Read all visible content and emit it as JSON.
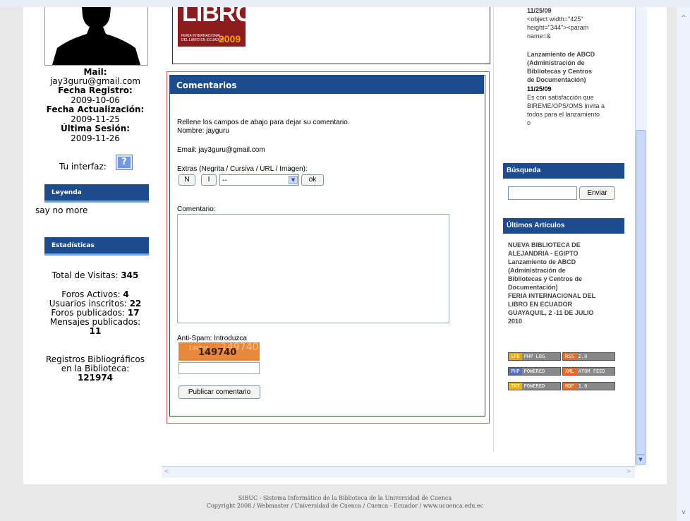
{
  "profile": {
    "mail_label": "Mail:",
    "mail_value": "jay3guru@gmail.com",
    "registro_label": "Fecha Registro:",
    "registro_value": "2009-10-06",
    "actualizacion_label": "Fecha Actualización:",
    "actualizacion_value": "2009-11-25",
    "sesion_label": "Última Sesión:",
    "sesion_value": "2009-11-26",
    "interfaz_label": "Tu interfaz:",
    "interfaz_icon": "?"
  },
  "leyenda": {
    "title": "Leyenda",
    "text": "say no more"
  },
  "estadisticas": {
    "title": "Estadísticas",
    "visitas_label": "Total de Visitas:",
    "visitas_value": "345",
    "foros_label": "Foros Activos:",
    "foros_value": "4",
    "usuarios_label": "Usuarios inscritos:",
    "usuarios_value": "22",
    "foros_pub_label": "Foros publicados:",
    "foros_pub_value": "17",
    "mensajes_label": "Mensajes publicados:",
    "mensajes_value": "11",
    "registros_label_1": "Registros Bibliográficos",
    "registros_label_2": "en la Biblioteca:",
    "registros_value": "121974"
  },
  "logo": {
    "text": "LIBRO",
    "small_1": "FERIA INTERNACIONAL",
    "small_2": "DEL LIBRO EN ECUADOR",
    "year": "2009"
  },
  "comentarios": {
    "title": "Comentarios",
    "intro": "Rellene los campos de abajo para dejar su comentario.",
    "nombre": "Nombre: jayguru",
    "email": "Email: jay3guru@gmail.com",
    "extras_label": "Extras (Negrita / Cursiva / URL / Imagen):",
    "btn_n": "N",
    "btn_i": "I",
    "select_value": "--",
    "btn_ok": "ok",
    "comentario_label": "Comentario:",
    "antispam_label": "Anti-Spam: Introduzca",
    "captcha_code": "149740",
    "submit": "Publicar comentario"
  },
  "right": {
    "top_date": "11/25/09",
    "top_code_1": "<object width=\"425\"",
    "top_code_2": "height=\"344\"><param",
    "top_code_3": "name=&",
    "article_title_1": "Lanzamiento de ABCD",
    "article_title_2": "(Administración de",
    "article_title_3": "Bibliotecas y Centros",
    "article_title_4": "de Documentación)",
    "article_date": "11/25/09",
    "article_text_1": "Es con satisfacción que",
    "article_text_2": "BIREME/OPS/OMS invita a",
    "article_text_3": "todos para el lanzamiento",
    "article_text_4": "o",
    "busqueda_title": "Búsqueda",
    "search_placeholder": "",
    "enviar": "Enviar",
    "ultimos_title": "Últimos Artículos",
    "ult_1": "NUEVA BIBLIOTECA DE",
    "ult_2": "ALEJANDRIA - EGIPTO",
    "ult_3": "Lanzamiento de ABCD",
    "ult_4": "(Administración de",
    "ult_5": "Bibliotecas y Centros de",
    "ult_6": "Documentación)",
    "ult_7": "FERIA INTERNACIONAL DEL",
    "ult_8": "LIBRO EN ECUADOR",
    "ult_9": "GUAYAQUIL, 2 -11 DE JULIO",
    "ult_10": "2010",
    "badges": [
      {
        "left": "SPB",
        "right": "PHP LOG",
        "lcolor": "#e6a800"
      },
      {
        "left": "RSS",
        "right": "2.0",
        "lcolor": "#f06a1d"
      },
      {
        "left": "PHP",
        "right": "POWERED",
        "lcolor": "#5a6fb5"
      },
      {
        "left": "XML",
        "right": "ATOM FEED",
        "lcolor": "#f06a1d"
      },
      {
        "left": "TXT",
        "right": "POWERED",
        "lcolor": "#f0b400"
      },
      {
        "left": "RDF",
        "right": "1.0",
        "lcolor": "#f06a1d"
      }
    ]
  },
  "footer": {
    "line1": "SIBUC - Sistema Informático de la Biblioteca de la Universidad de Cuenca",
    "line2": "Copyright 2008 / Webmaster / Universidad de Cuenca / Cuenca - Ecuador / www.ucuenca.edu.ec"
  }
}
